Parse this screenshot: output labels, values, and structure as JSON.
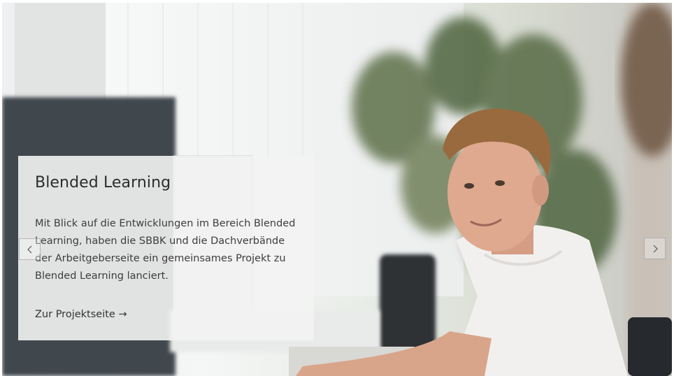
{
  "slide": {
    "title": "Blended Learning",
    "text": "Mit Blick auf die Entwicklungen im Bereich Blended Learning, haben die SBBK und die Dachverbände der Arbeitgeberseite ein gemeinsames Projekt zu Blended Learning lanciert.",
    "link_label": "Zur Projektseite →"
  },
  "carousel": {
    "prev_icon": "chevron-left-icon",
    "next_icon": "chevron-right-icon"
  },
  "image": {
    "subject": "photo-office-young-man-smiling"
  }
}
